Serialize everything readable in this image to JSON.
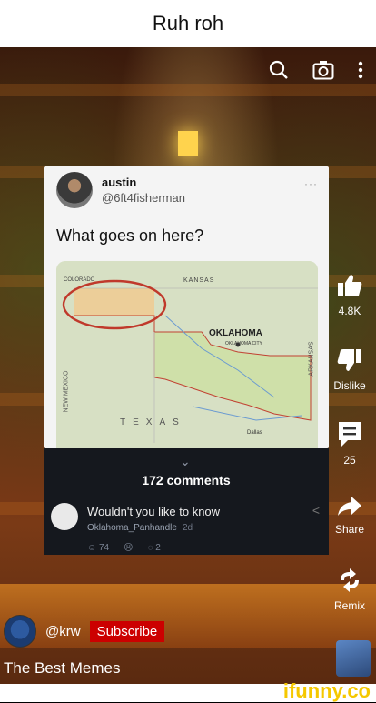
{
  "caption": "Ruh roh",
  "tweet": {
    "name": "austin",
    "handle": "@6ft4fisherman",
    "more": "···",
    "question": "What goes on here?"
  },
  "map_labels": {
    "colorado": "COLORADO",
    "kansas": "KANSAS",
    "oklahoma": "OKLAHOMA",
    "oklahoma_city": "OKLAHOMA CITY",
    "texas": "TEXAS",
    "new_mexico": "NEW MEXICO",
    "arkansas": "ARKANSAS",
    "dallas": "Dallas"
  },
  "comments": {
    "chevron": "⌄",
    "count": "172 comments",
    "text": "Wouldn't you like to know",
    "user": "Oklahoma_Panhandle",
    "age": "2d",
    "likes": "74",
    "replies": "2"
  },
  "actions": {
    "likes": "4.8K",
    "dislike": "Dislike",
    "comments": "25",
    "share": "Share",
    "remix": "Remix"
  },
  "uploader": {
    "handle": "@krw",
    "subscribe": "Subscribe"
  },
  "video_title": "The Best Memes",
  "watermark": "ifunny.co",
  "colors": {
    "subscribe": "#cc0000",
    "ifunny": "#f5c800",
    "panhandle_circle": "#c0392b"
  }
}
